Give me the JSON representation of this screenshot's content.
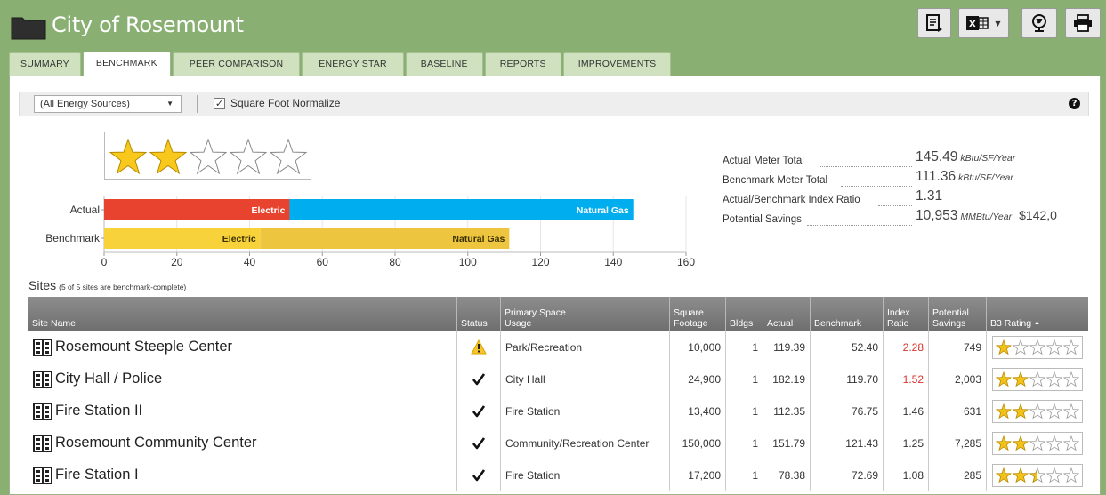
{
  "app": {
    "title": "City of Rosemount"
  },
  "tabs": [
    {
      "label": "SUMMARY",
      "active": false
    },
    {
      "label": "BENCHMARK",
      "active": true
    },
    {
      "label": "PEER COMPARISON",
      "active": false
    },
    {
      "label": "ENERGY STAR",
      "active": false
    },
    {
      "label": "BASELINE",
      "active": false
    },
    {
      "label": "REPORTS",
      "active": false
    },
    {
      "label": "IMPROVEMENTS",
      "active": false
    }
  ],
  "toolbar": {
    "energy_source": "(All Energy Sources)",
    "normalize_label": "Square Foot Normalize",
    "normalize_checked": true
  },
  "rating": {
    "stars": 2,
    "max": 5
  },
  "chart_data": {
    "type": "bar",
    "orientation": "horizontal",
    "stacked": true,
    "categories": [
      "Actual",
      "Benchmark"
    ],
    "series": [
      {
        "name": "Electric",
        "values": [
          51,
          43
        ],
        "colors": [
          "#e8432e",
          "#f7d23a"
        ]
      },
      {
        "name": "Natural Gas",
        "values": [
          94.5,
          68.4
        ],
        "colors": [
          "#00aeef",
          "#edc53e"
        ]
      }
    ],
    "xlim": [
      0,
      160
    ],
    "xticks": [
      0,
      20,
      40,
      60,
      80,
      100,
      120,
      140,
      160
    ],
    "grid": true
  },
  "stats": [
    {
      "label": "Actual Meter Total",
      "value": "145.49",
      "unit": "kBtu/SF/Year"
    },
    {
      "label": "Benchmark Meter Total",
      "value": "111.36",
      "unit": "kBtu/SF/Year"
    },
    {
      "label": "Actual/Benchmark Index Ratio",
      "value": "1.31",
      "unit": ""
    },
    {
      "label": "Potential Savings",
      "value": "10,953",
      "unit": "MMBtu/Year",
      "extra": "$142,0"
    }
  ],
  "sites": {
    "title": "Sites",
    "subtitle": "(5 of 5 sites are benchmark-complete)",
    "columns": {
      "site_name": "Site Name",
      "status": "Status",
      "usage": [
        "Primary Space",
        "Usage"
      ],
      "sqft": [
        "Square",
        "Footage"
      ],
      "bldgs": "Bldgs",
      "actual": "Actual",
      "benchmark": "Benchmark",
      "index": [
        "Index",
        "Ratio"
      ],
      "savings": [
        "Potential",
        "Savings"
      ],
      "rating": "B3 Rating"
    },
    "rows": [
      {
        "name": "Rosemount Steeple Center",
        "status": "warning",
        "usage": "Park/Recreation",
        "sqft": "10,000",
        "bldgs": "1",
        "actual": "119.39",
        "benchmark": "52.40",
        "index": "2.28",
        "index_high": true,
        "savings": "749",
        "rating": 1
      },
      {
        "name": "City Hall / Police",
        "status": "ok",
        "usage": "City Hall",
        "sqft": "24,900",
        "bldgs": "1",
        "actual": "182.19",
        "benchmark": "119.70",
        "index": "1.52",
        "index_high": true,
        "savings": "2,003",
        "rating": 2
      },
      {
        "name": "Fire Station II",
        "status": "ok",
        "usage": "Fire Station",
        "sqft": "13,400",
        "bldgs": "1",
        "actual": "112.35",
        "benchmark": "76.75",
        "index": "1.46",
        "index_high": false,
        "savings": "631",
        "rating": 2
      },
      {
        "name": "Rosemount Community Center",
        "status": "ok",
        "usage": "Community/Recreation Center",
        "sqft": "150,000",
        "bldgs": "1",
        "actual": "151.79",
        "benchmark": "121.43",
        "index": "1.25",
        "index_high": false,
        "savings": "7,285",
        "rating": 2
      },
      {
        "name": "Fire Station I",
        "status": "ok",
        "usage": "Fire Station",
        "sqft": "17,200",
        "bldgs": "1",
        "actual": "78.38",
        "benchmark": "72.69",
        "index": "1.08",
        "index_high": false,
        "savings": "285",
        "rating": 2.5
      }
    ]
  },
  "icons": [
    "folder-icon",
    "notes-export-icon",
    "excel-export-icon",
    "globe-icon",
    "print-icon",
    "help-icon",
    "building-icon",
    "warning-icon",
    "checkmark-icon",
    "star-icon"
  ],
  "colors": {
    "header_bg": "#8aaf73",
    "electric_actual": "#e8432e",
    "gas_actual": "#00aeef",
    "benchmark_electric": "#f7d23a",
    "benchmark_gas": "#edc53e",
    "index_high": "#d9342b"
  }
}
